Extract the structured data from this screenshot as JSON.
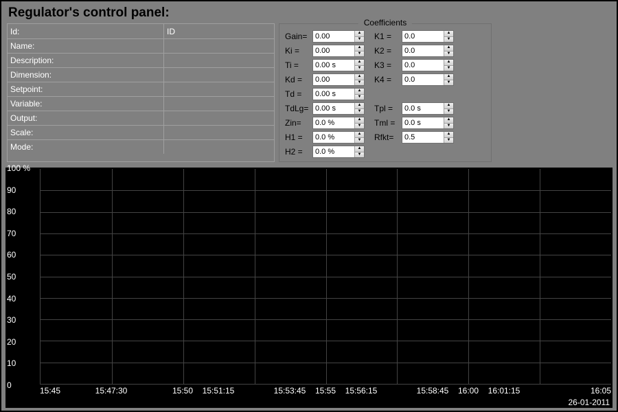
{
  "title": "Regulator's control panel:",
  "properties": [
    {
      "label": "Id:",
      "value": "ID"
    },
    {
      "label": "Name:",
      "value": ""
    },
    {
      "label": "Description:",
      "value": ""
    },
    {
      "label": "Dimension:",
      "value": ""
    },
    {
      "label": "Setpoint:",
      "value": ""
    },
    {
      "label": "Variable:",
      "value": ""
    },
    {
      "label": "Output:",
      "value": ""
    },
    {
      "label": "Scale:",
      "value": ""
    },
    {
      "label": "Mode:",
      "value": ""
    }
  ],
  "coefficients": {
    "legend": "Coefficients",
    "left": [
      {
        "label": "Gain=",
        "value": "0.00"
      },
      {
        "label": "Ki =",
        "value": "0.00"
      },
      {
        "label": "Ti =",
        "value": "0.00 s"
      },
      {
        "label": "Kd =",
        "value": "0.00"
      },
      {
        "label": "Td =",
        "value": "0.00 s"
      },
      {
        "label": "TdLg=",
        "value": "0.00 s"
      },
      {
        "label": "Zin=",
        "value": "0.0 %"
      },
      {
        "label": "H1 =",
        "value": "0.0 %"
      },
      {
        "label": "H2 =",
        "value": "0.0 %"
      }
    ],
    "right": [
      {
        "label": "K1 =",
        "value": "0.0"
      },
      {
        "label": "K2 =",
        "value": "0.0"
      },
      {
        "label": "K3 =",
        "value": "0.0"
      },
      {
        "label": "K4 =",
        "value": "0.0"
      },
      {
        "label": "Tpl =",
        "value": "0.0 s"
      },
      {
        "label": "Tml =",
        "value": "0.0 s"
      },
      {
        "label": "Rfkt=",
        "value": "0.5"
      }
    ]
  },
  "chart_data": {
    "type": "line",
    "series": [],
    "ylabel": "%",
    "ylim": [
      0,
      100
    ],
    "y_ticks": [
      "100 %",
      "90",
      "80",
      "70",
      "60",
      "50",
      "40",
      "30",
      "20",
      "10",
      "0"
    ],
    "x_ticks": [
      "15:45",
      "15:47:30",
      "15:50",
      "15:51:15",
      "15:53:45",
      "15:55",
      "15:56:15",
      "15:58:45",
      "16:00",
      "16:01:15",
      "16:05"
    ],
    "x_positions_pct": [
      0,
      12.5,
      25,
      31.25,
      43.75,
      50,
      56.25,
      68.75,
      75,
      81.25,
      100
    ],
    "date": "26-01-2011"
  }
}
